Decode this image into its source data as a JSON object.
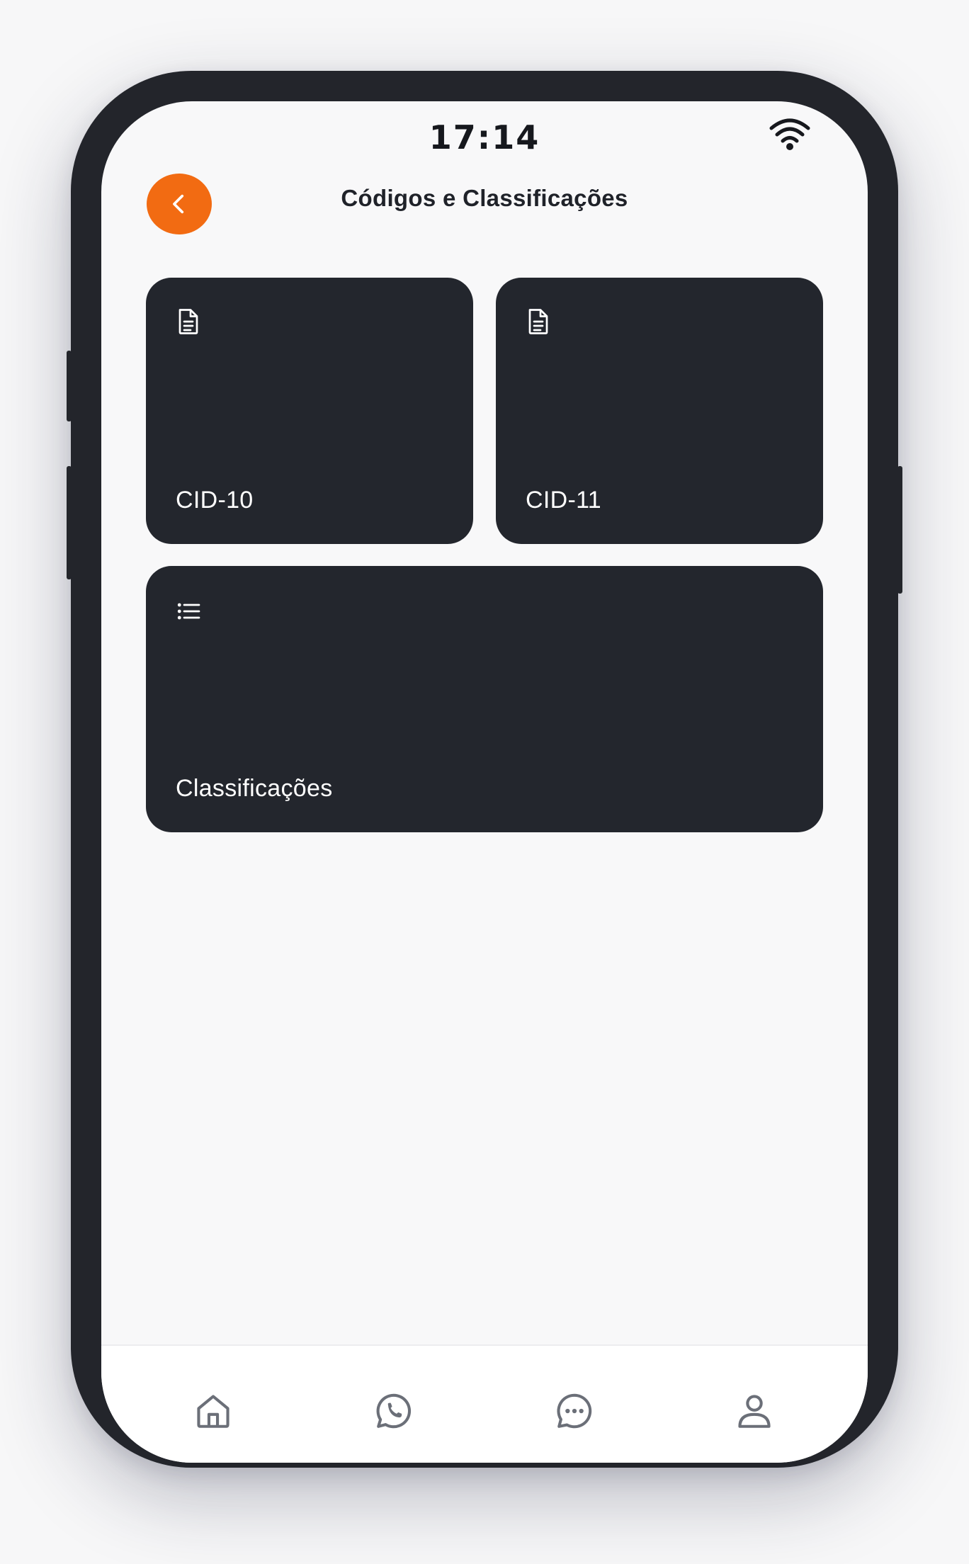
{
  "status_bar": {
    "time": "17:14",
    "wifi_icon": "wifi-icon"
  },
  "header": {
    "back_icon": "chevron-left-icon",
    "title": "Códigos e Classificações"
  },
  "cards": [
    {
      "icon": "document-icon",
      "label": "CID-10"
    },
    {
      "icon": "document-icon",
      "label": "CID-11"
    },
    {
      "icon": "list-icon",
      "label": "Classificações"
    }
  ],
  "tab_bar": {
    "items": [
      {
        "icon": "home-icon"
      },
      {
        "icon": "whatsapp-icon"
      },
      {
        "icon": "chat-icon"
      },
      {
        "icon": "user-icon"
      }
    ]
  },
  "colors": {
    "accent": "#f26b12",
    "card_background": "#23262d",
    "frame": "#23252b",
    "screen_background": "#f8f8f9",
    "tab_icon": "#6b6f78"
  }
}
